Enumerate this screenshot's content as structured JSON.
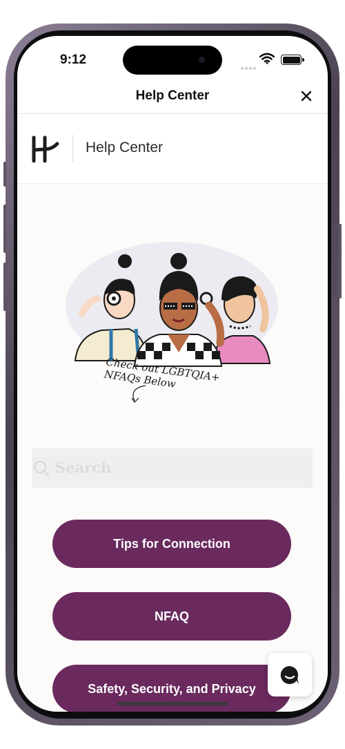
{
  "status_bar": {
    "time": "9:12"
  },
  "nav": {
    "title": "Help Center",
    "close_icon": "close-icon"
  },
  "brand": {
    "logo_icon": "hinge-logo-icon",
    "title": "Help Center"
  },
  "illustration": {
    "caption_line1": "Check out LGBTQIA+",
    "caption_line2": "NFAQs Below"
  },
  "search": {
    "placeholder": "Search"
  },
  "buttons": [
    {
      "label": "Tips for Connection"
    },
    {
      "label": "NFAQ"
    },
    {
      "label": "Safety, Security, and Privacy"
    }
  ],
  "colors": {
    "accent": "#6a2a5e",
    "background": "#fcfbfa"
  },
  "chat": {
    "icon": "chat-bubble-icon"
  }
}
